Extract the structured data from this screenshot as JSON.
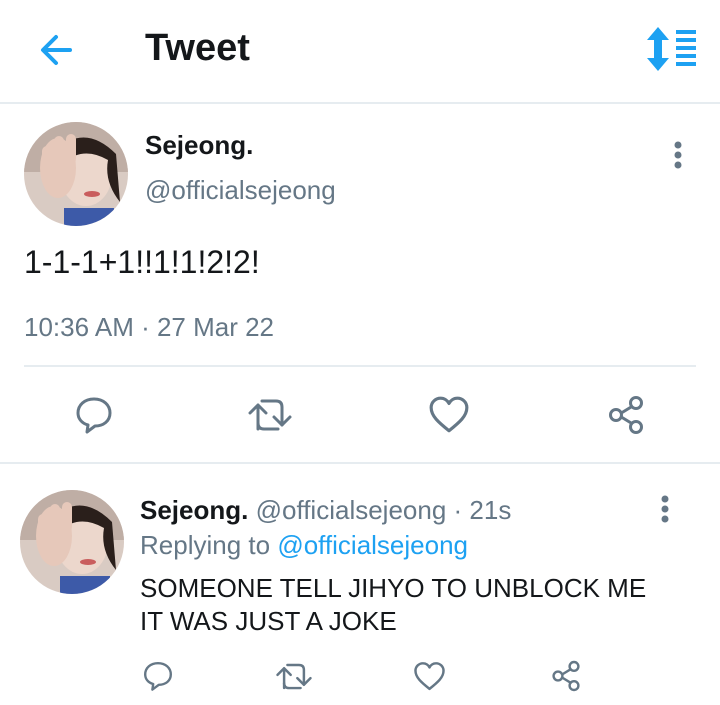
{
  "header": {
    "title": "Tweet",
    "back_icon": "back-arrow-icon",
    "sort_icon": "sort-icon",
    "accent": "#1da1f2"
  },
  "tweet": {
    "display_name": "Sejeong.",
    "handle": "@officialsejeong",
    "text": "1-1-1+1!!1!1!2!2!",
    "timestamp": "10:36 AM · 27 Mar 22",
    "actions": [
      "reply-icon",
      "retweet-icon",
      "like-icon",
      "share-icon"
    ]
  },
  "reply": {
    "display_name": "Sejeong.",
    "handle": "@officialsejeong",
    "time": " · 21s",
    "replying_prefix": "Replying to ",
    "replying_handle": "@officialsejeong",
    "text_line1": "SOMEONE TELL JIHYO TO UNBLOCK ME",
    "text_line2": "IT WAS JUST A JOKE",
    "actions": [
      "reply-icon",
      "retweet-icon",
      "like-icon",
      "share-icon"
    ]
  }
}
